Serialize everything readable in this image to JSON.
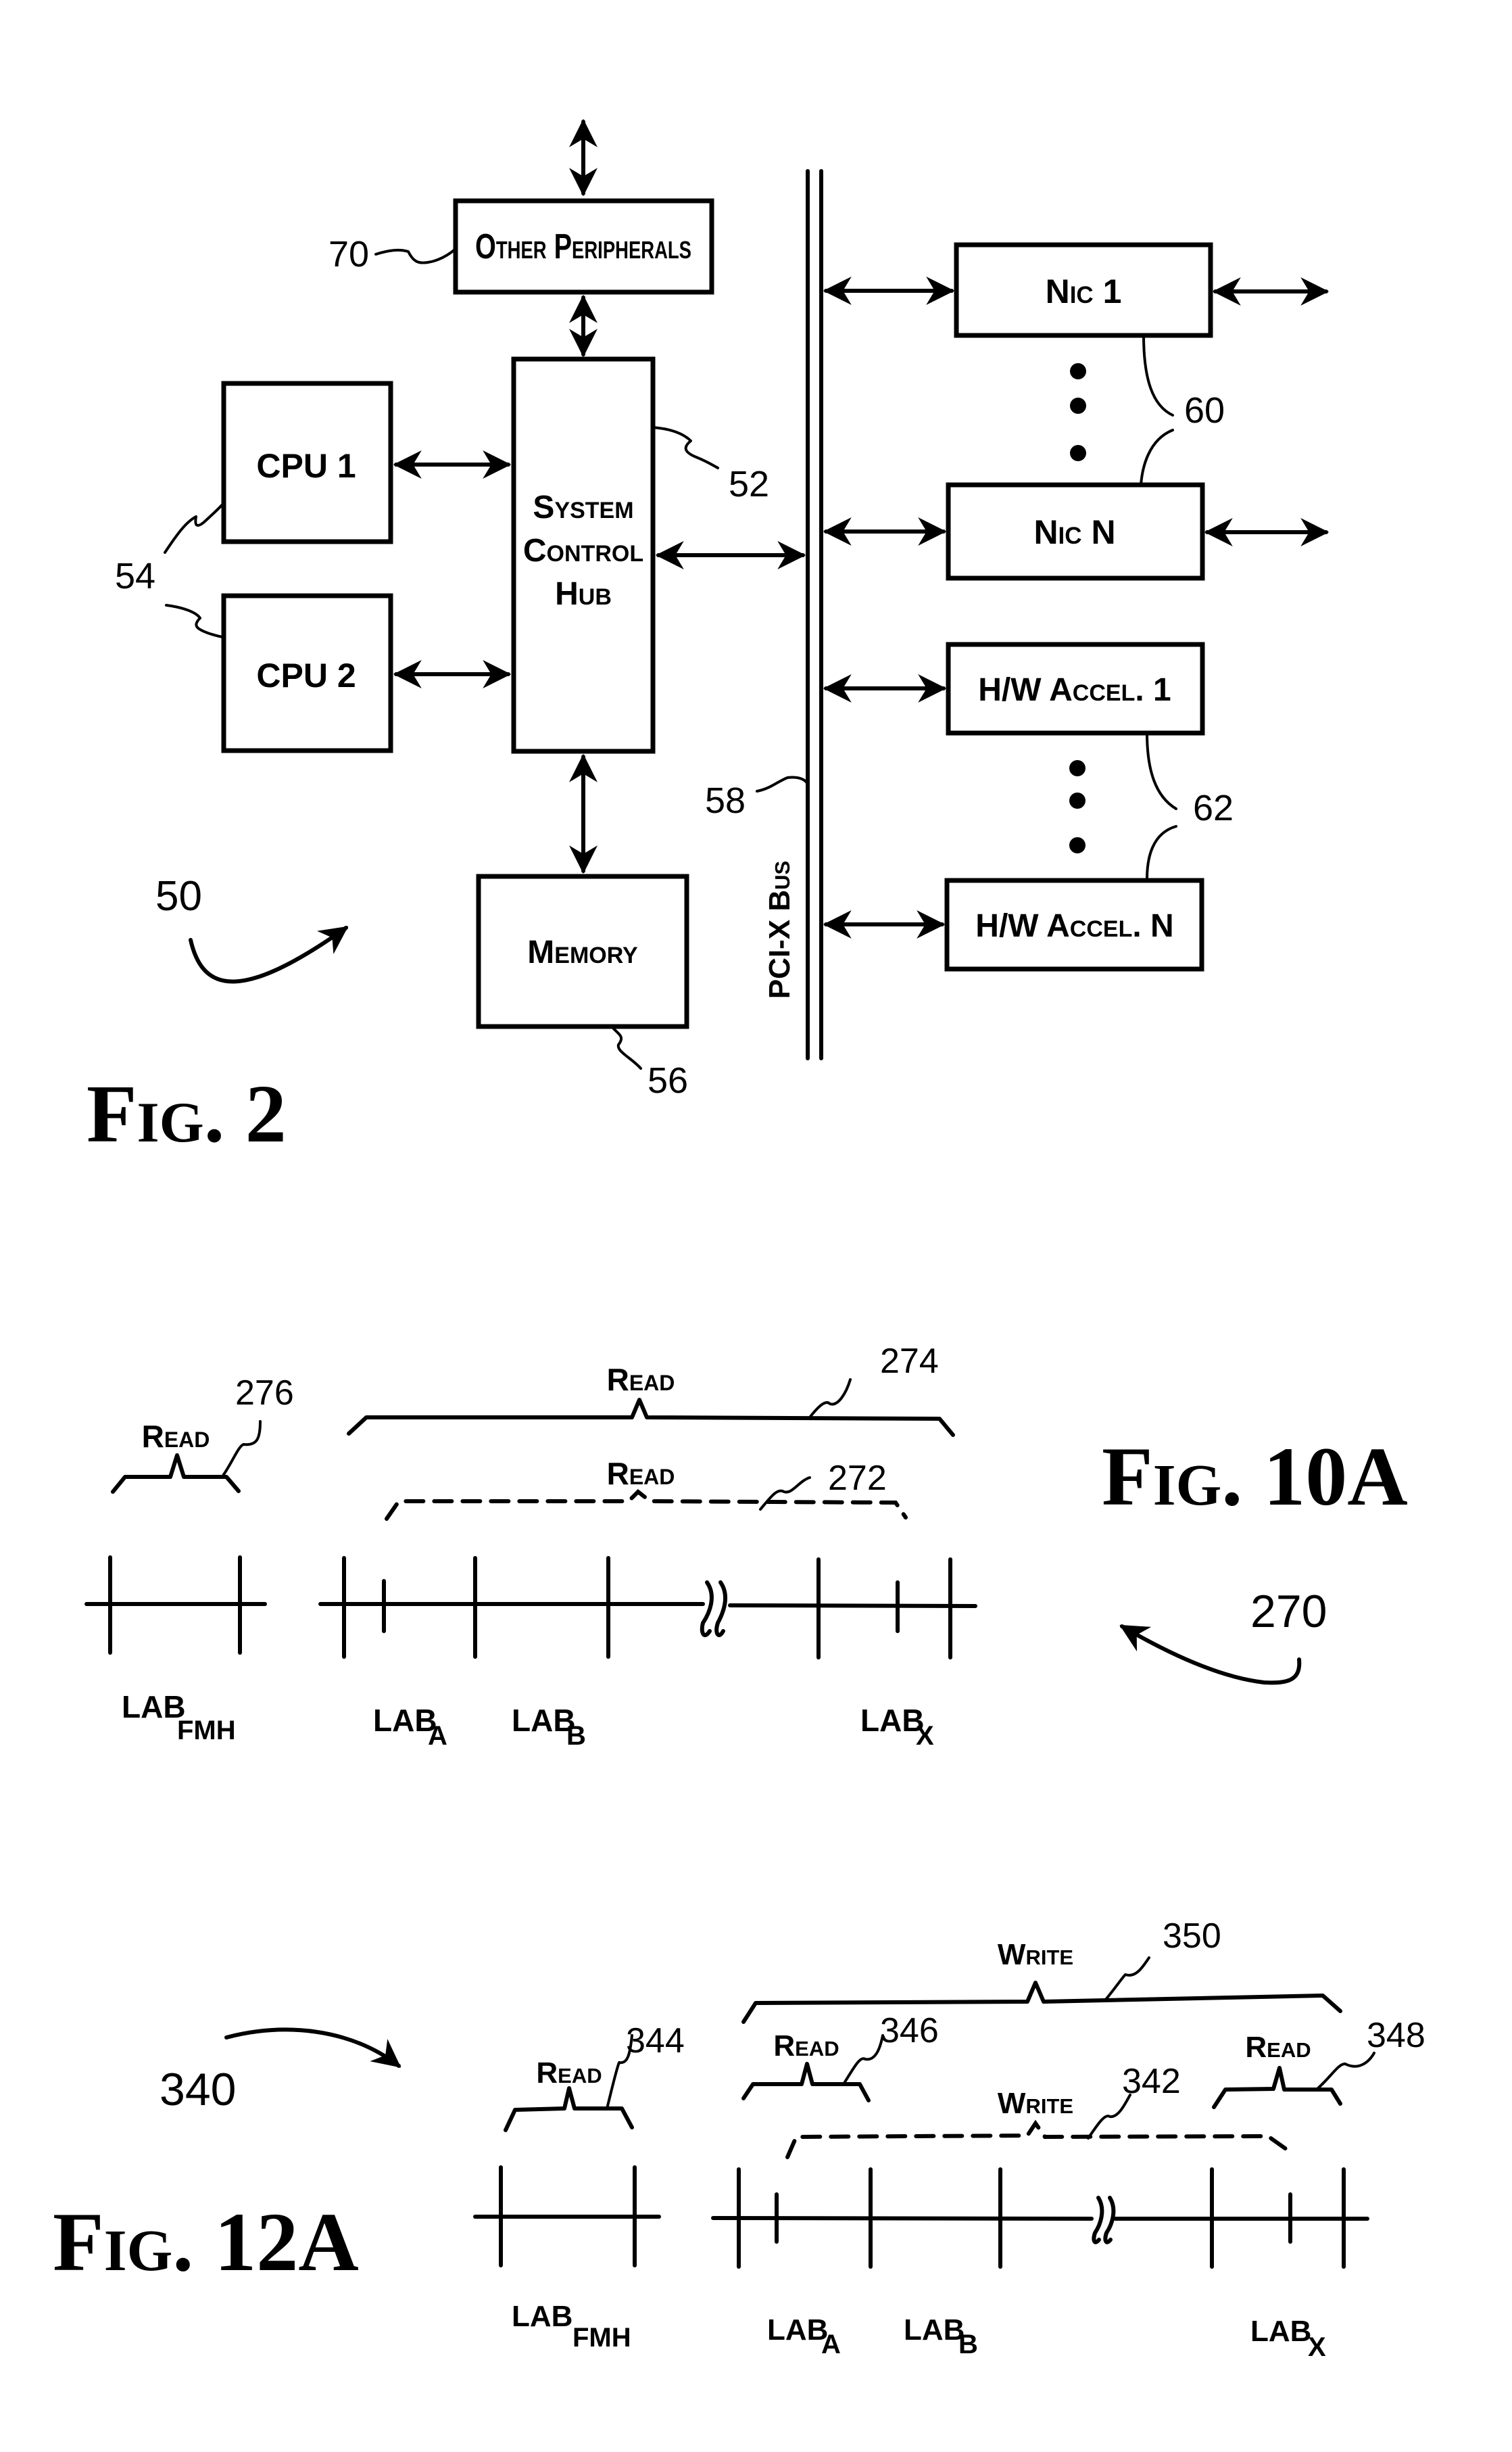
{
  "colors": {
    "ink": "#000000",
    "paper": "#ffffff"
  },
  "fig2": {
    "caption": "Fig. 2",
    "system_ref": "50",
    "blocks": {
      "other_peripherals": {
        "label": "Other Peripherals",
        "ref": "70"
      },
      "cpu1": {
        "label": "CPU 1"
      },
      "cpu2": {
        "label": "CPU 2"
      },
      "cpu_ref": "54",
      "system_control_hub": {
        "line1": "System",
        "line2": "Control",
        "line3": "Hub",
        "ref": "52"
      },
      "memory": {
        "label": "Memory",
        "ref": "56"
      },
      "bus": {
        "label": "PCI-X Bus",
        "ref": "58"
      },
      "nic1": {
        "label": "Nic 1"
      },
      "nicN": {
        "label": "Nic N"
      },
      "nic_ref": "60",
      "hw1": {
        "label": "H/W Accel. 1"
      },
      "hwN": {
        "label": "H/W Accel. N"
      },
      "hw_ref": "62"
    }
  },
  "fig10a": {
    "caption": "Fig. 10A",
    "ref": "270",
    "brackets": [
      {
        "label": "Read",
        "ref": "276",
        "style": "solid"
      },
      {
        "label": "Read",
        "ref": "274",
        "style": "solid"
      },
      {
        "label": "Read",
        "ref": "272",
        "style": "dashed"
      }
    ],
    "labs": [
      {
        "main": "LAB",
        "sub": "FMH"
      },
      {
        "main": "LAB",
        "sub": "A"
      },
      {
        "main": "LAB",
        "sub": "B"
      },
      {
        "main": "LAB",
        "sub": "X"
      }
    ]
  },
  "fig12a": {
    "caption": "Fig. 12A",
    "ref": "340",
    "brackets": [
      {
        "label": "Write",
        "ref": "350",
        "style": "solid"
      },
      {
        "label": "Read",
        "ref": "344",
        "style": "solid"
      },
      {
        "label": "Read",
        "ref": "346",
        "style": "solid"
      },
      {
        "label": "Read",
        "ref": "348",
        "style": "solid"
      },
      {
        "label": "Write",
        "ref": "342",
        "style": "dashed"
      }
    ],
    "labs": [
      {
        "main": "LAB",
        "sub": "FMH"
      },
      {
        "main": "LAB",
        "sub": "A"
      },
      {
        "main": "LAB",
        "sub": "B"
      },
      {
        "main": "LAB",
        "sub": "X"
      }
    ]
  }
}
